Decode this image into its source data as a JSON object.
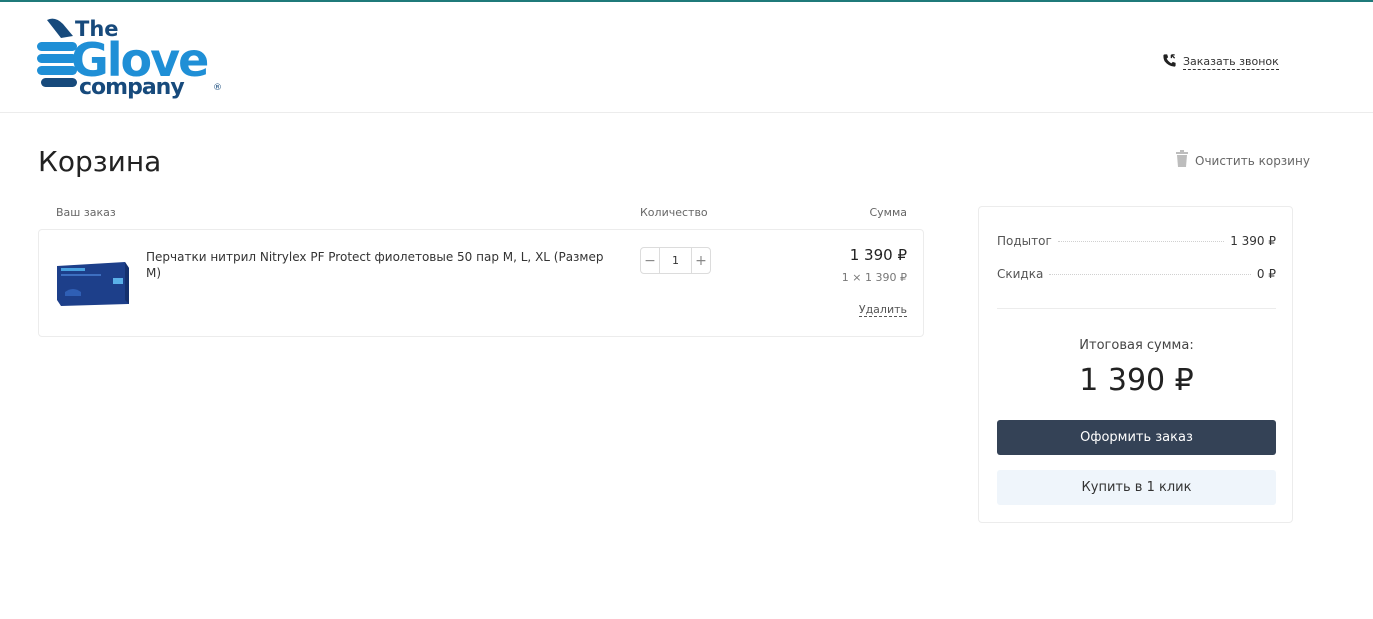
{
  "header": {
    "logo_word_1": "The",
    "logo_word_2": "Glove",
    "logo_word_3": "company",
    "logo_mark": "®",
    "callback_label": "Заказать звонок",
    "callback_icon": "phone-icon"
  },
  "page": {
    "title": "Корзина",
    "clear_cart_label": "Очистить корзину",
    "clear_cart_icon": "trash-icon"
  },
  "cart": {
    "columns": {
      "order": "Ваш заказ",
      "quantity": "Количество",
      "sum": "Сумма"
    },
    "items": [
      {
        "name": "Перчатки нитрил Nitrylex PF Protect фиолетовые 50 пар M, L, XL (Размер M)",
        "quantity": "1",
        "minus": "−",
        "plus": "+",
        "price": "1 390 ₽",
        "unit_price": "1 × 1 390 ₽",
        "delete_label": "Удалить"
      }
    ]
  },
  "summary": {
    "subtotal_label": "Подытог",
    "subtotal_value": "1 390 ₽",
    "discount_label": "Скидка",
    "discount_value": "0 ₽",
    "total_label": "Итоговая сумма:",
    "total_value": "1 390 ₽",
    "checkout_label": "Оформить заказ",
    "one_click_label": "Купить в 1 клик"
  },
  "colors": {
    "logo_blue": "#1f8fd6",
    "logo_navy": "#174a7c",
    "primary_button": "#344256",
    "secondary_button": "#eff5fb",
    "accent_line": "#1f7a7a"
  }
}
